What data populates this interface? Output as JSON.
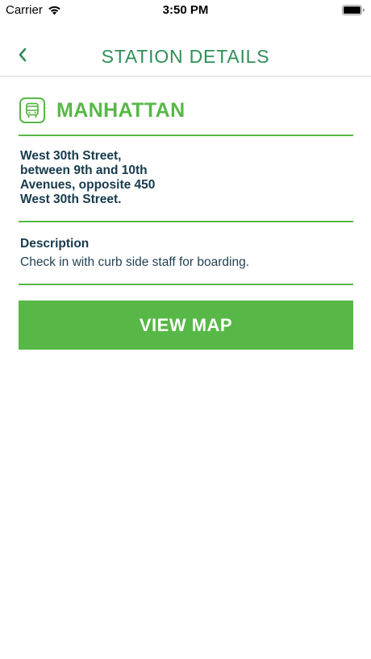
{
  "status_bar": {
    "carrier": "Carrier",
    "time": "3:50 PM",
    "icons": [
      "wifi-icon",
      "battery-icon"
    ]
  },
  "nav": {
    "title": "STATION DETAILS",
    "back_icon": "chevron-left-icon"
  },
  "station": {
    "icon": "bus-icon",
    "name": "MANHATTAN",
    "address_lines": [
      "West 30th Street,",
      "between 9th and 10th",
      "Avenues, opposite 450",
      "West 30th Street."
    ],
    "description_label": "Description",
    "description": "Check in with curb side staff for boarding."
  },
  "actions": {
    "view_map_label": "VIEW MAP"
  },
  "colors": {
    "accent_green": "#57b847",
    "title_green": "#2f8f57",
    "text_dark": "#173a4c"
  }
}
